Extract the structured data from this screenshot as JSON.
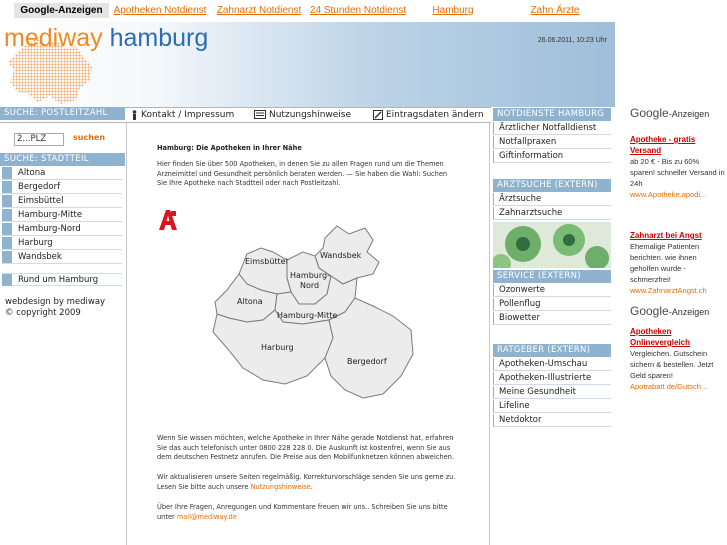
{
  "top_ads": {
    "label": "Google-Anzeigen",
    "links": [
      "Apotheken Notdienst",
      "Zahnarzt Notdienst",
      "24 Stunden Notdienst",
      "Hamburg",
      "Zahn Ärzte"
    ]
  },
  "header": {
    "logo_part1": "mediway",
    "logo_part2": "hamburg",
    "datetime": "26.06.2011, 10:23 Uhr"
  },
  "nav": {
    "kontakt": "Kontakt / Impressum",
    "hinweise": "Nutzungshinweise",
    "eintrag": "Eintragsdaten ändern"
  },
  "left": {
    "plz_header": "SUCHE: POSTLEITZAHL",
    "plz_value": "2...PLZ",
    "suchen": "suchen",
    "stadtteil_header": "SUCHE: STADTTEIL",
    "stadtteile": [
      "Altona",
      "Bergedorf",
      "Eimsbüttel",
      "Hamburg-Mitte",
      "Hamburg-Nord",
      "Harburg",
      "Wandsbek"
    ],
    "rund": "Rund um Hamburg",
    "credit1": "webdesign by mediway",
    "credit2": "© copyright 2009"
  },
  "main": {
    "title": "Hamburg: Die Apotheken in Ihrer Nähe",
    "intro": "Hier finden Sie über 500 Apotheken, in denen Sie zu allen Fragen rund um die Themen Arzneimittel und Gesundheit persönlich beraten werden. — Sie haben die Wahl: Suchen Sie Ihre Apotheke nach Stadtteil oder nach Postleitzahl.",
    "map_labels": [
      "Eimsbüttel",
      "Wandsbek",
      "Hamburg-",
      "Nord",
      "Altona",
      "Hamburg-Mitte",
      "Harburg",
      "Bergedorf"
    ],
    "p1": "Wenn Sie wissen möchten, welche Apotheke in Ihrer Nähe gerade Notdienst hat, erfahren Sie das auch telefonisch unter 0800 228 228 0. Die Auskunft ist kostenfrei, wenn Sie aus dem deutschen Festnetz anrufen. Die Preise aus den Mobilfunknetzen können abweichen.",
    "p2a": "Wir aktualisieren unsere Seiten regelmäßig. Korrekturvorschläge senden Sie uns gerne zu. Lesen Sie bitte auch unsere ",
    "p2link": "Nutzungshinweise",
    "p2b": ".",
    "p3a": "Über Ihre Fragen, Anregungen und Kommentare freuen wir uns.. Schreiben Sie uns bitte unter ",
    "p3link": "mail@mediway.de"
  },
  "right": {
    "notdienste_header": "NOTDIENSTE HAMBURG",
    "notdienste": [
      "Ärztlicher Notfalldienst",
      "Notfallpraxen",
      "Giftinformation"
    ],
    "arztsuche_header": "ARZTSUCHE (EXTERN)",
    "arztsuche": [
      "Ärztsuche",
      "Zahnarztsuche"
    ],
    "service_header": "SERVICE (EXTERN)",
    "service": [
      "Ozonwerte",
      "Pollenflug",
      "Biowetter"
    ],
    "ratgeber_header": "RATGEBER (EXTERN)",
    "ratgeber": [
      "Apotheken-Umschau",
      "Apotheken-Illustrierte",
      "Meine Gesundheit",
      "Lifeline",
      "Netdoktor"
    ]
  },
  "ads": {
    "label_google": "Google",
    "label_anzeigen": "-Anzeigen",
    "ad1_title": "Apotheke - gratis Versand",
    "ad1_body": "ab 20 € - Bis zu 60% sparen! schneller Versand in 24h",
    "ad1_url": "www.Apotheke.apodi...",
    "ad2_title": "Zahnarzt bei Angst",
    "ad2_body": "Ehemalige Patienten berichten. wie ihnen geholfen wurde - schmerzfrei!",
    "ad2_url": "www.ZahnarztAngst.ch",
    "ad3_title": "Apotheken Onlinevergleich",
    "ad3_body": "Vergleichen. Gutschein sichern & bestellen. Jetzt Geld sparen!",
    "ad3_url": "Apotrabatt.de/Gutsch..."
  },
  "colors": {
    "accent_blue": "#8fb2cf",
    "logo_orange": "#f08a1e",
    "logo_blue": "#2b6db4",
    "link_orange": "#e86d00",
    "ad_red": "#cc0000"
  }
}
